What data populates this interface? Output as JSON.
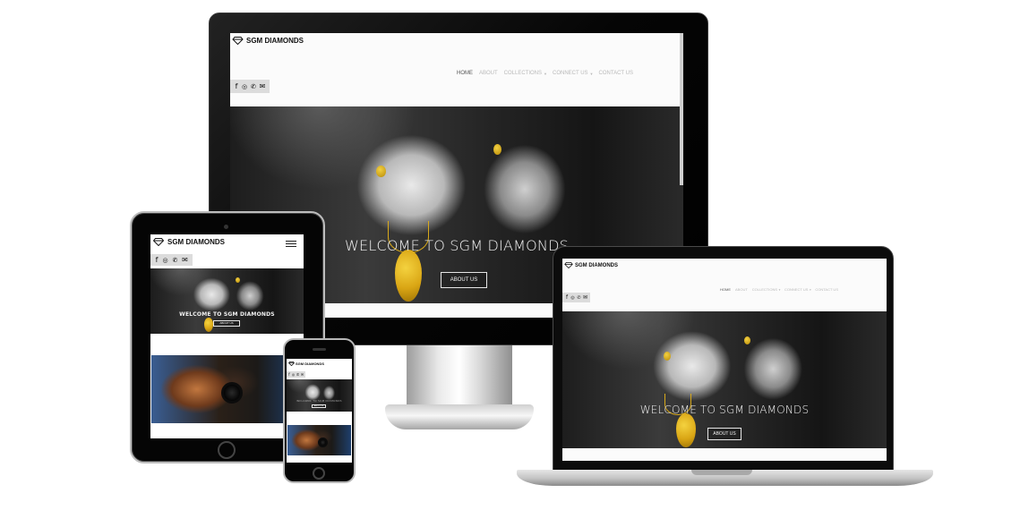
{
  "site": {
    "brand_name": "SGM DIAMONDS",
    "logo_icon": "diamond-icon",
    "nav": [
      {
        "label": "HOME",
        "active": true,
        "dropdown": false
      },
      {
        "label": "ABOUT",
        "active": false,
        "dropdown": false
      },
      {
        "label": "COLLECTIONS",
        "active": false,
        "dropdown": true
      },
      {
        "label": "CONNECT US",
        "active": false,
        "dropdown": true
      },
      {
        "label": "CONTACT US",
        "active": false,
        "dropdown": false
      }
    ],
    "social": [
      {
        "icon": "facebook-icon",
        "glyph": "f"
      },
      {
        "icon": "instagram-icon",
        "glyph": "◎"
      },
      {
        "icon": "whatsapp-icon",
        "glyph": "✆"
      },
      {
        "icon": "envelope-icon",
        "glyph": "✉"
      }
    ],
    "hero": {
      "welcome_text": "WELCOME TO SGM DIAMONDS",
      "about_button": "ABOUT US"
    },
    "menu_icon": "hamburger-menu-icon"
  },
  "colors": {
    "accent_gold": "#e0b21c",
    "nav_active": "#555555",
    "nav_inactive": "#b9b9b9",
    "social_bar": "#dcdcdc"
  }
}
